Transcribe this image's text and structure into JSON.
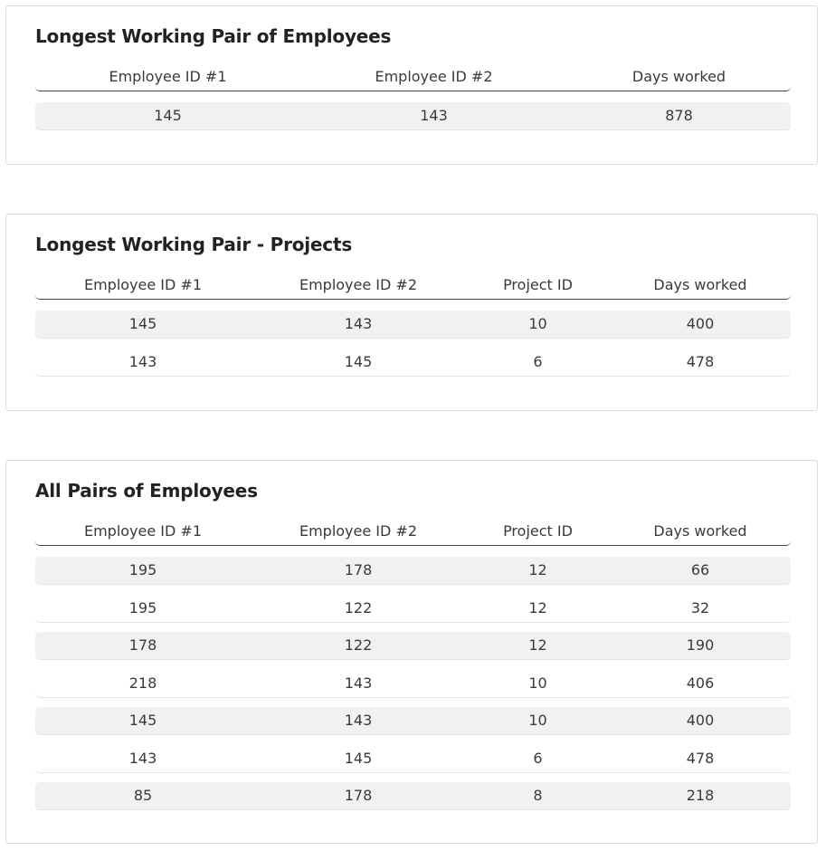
{
  "longest_pair": {
    "title": "Longest Working Pair of Employees",
    "columns": [
      "Employee ID #1",
      "Employee ID #2",
      "Days worked"
    ],
    "rows": [
      [
        "145",
        "143",
        "878"
      ]
    ]
  },
  "longest_pair_projects": {
    "title": "Longest Working Pair - Projects",
    "columns": [
      "Employee ID #1",
      "Employee ID #2",
      "Project ID",
      "Days worked"
    ],
    "rows": [
      [
        "145",
        "143",
        "10",
        "400"
      ],
      [
        "143",
        "145",
        "6",
        "478"
      ]
    ]
  },
  "all_pairs": {
    "title": "All Pairs of Employees",
    "columns": [
      "Employee ID #1",
      "Employee ID #2",
      "Project ID",
      "Days worked"
    ],
    "rows": [
      [
        "195",
        "178",
        "12",
        "66"
      ],
      [
        "195",
        "122",
        "12",
        "32"
      ],
      [
        "178",
        "122",
        "12",
        "190"
      ],
      [
        "218",
        "143",
        "10",
        "406"
      ],
      [
        "145",
        "143",
        "10",
        "400"
      ],
      [
        "143",
        "145",
        "6",
        "478"
      ],
      [
        "85",
        "178",
        "8",
        "218"
      ]
    ]
  }
}
